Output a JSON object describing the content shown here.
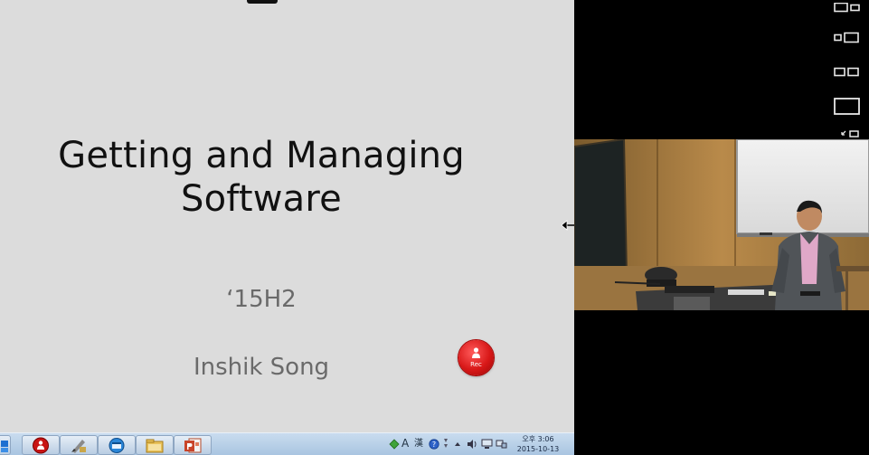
{
  "slide": {
    "title_line1": "Getting and Managing",
    "title_line2": "Software",
    "subtitle": "‘15H2",
    "author": "Inshik Song",
    "rec_label": "Rec"
  },
  "layout_panel": {
    "buttons": [
      {
        "icon": "layout-large-small-icon"
      },
      {
        "icon": "layout-small-large-icon"
      },
      {
        "icon": "layout-side-by-side-icon"
      },
      {
        "icon": "layout-single-icon"
      },
      {
        "icon": "layout-pip-swap-icon"
      }
    ]
  },
  "taskbar": {
    "apps": [
      {
        "icon": "start-icon"
      },
      {
        "icon": "recorder-app-icon"
      },
      {
        "icon": "paint-tools-icon"
      },
      {
        "icon": "browser-app-icon"
      },
      {
        "icon": "file-explorer-icon"
      },
      {
        "icon": "powerpoint-icon"
      }
    ],
    "tray": {
      "ime_letter": "A",
      "ime_hanja": "漢",
      "clock_time": "오후 3:06",
      "clock_date": "2015-10-13"
    }
  },
  "colors": {
    "slide_background": "#dcdcdc",
    "title_text": "#111111",
    "secondary_text": "#6a6a6a",
    "rec_red": "#d81818",
    "taskbar": "#b9cde3"
  }
}
